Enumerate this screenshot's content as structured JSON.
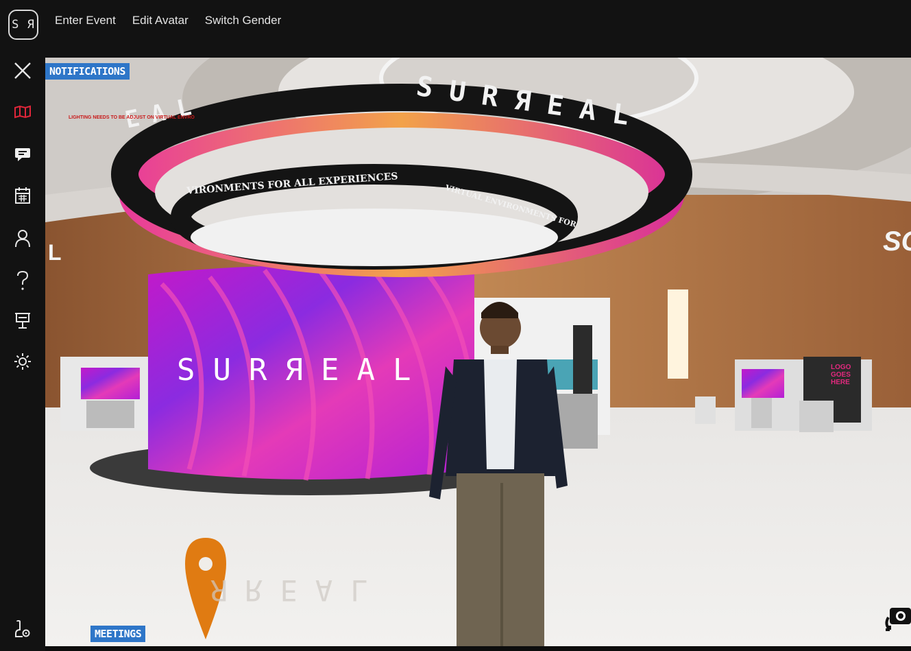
{
  "app": {
    "logo_text": "S Я"
  },
  "top_menu": {
    "items": [
      {
        "label": "Enter Event"
      },
      {
        "label": "Edit Avatar"
      },
      {
        "label": "Switch Gender"
      }
    ]
  },
  "sidebar": {
    "items": [
      {
        "icon": "close-icon"
      },
      {
        "icon": "map-icon",
        "color": "#e0263a"
      },
      {
        "icon": "chat-icon"
      },
      {
        "icon": "calendar-icon"
      },
      {
        "icon": "user-icon"
      },
      {
        "icon": "help-icon"
      },
      {
        "icon": "presentation-icon"
      },
      {
        "icon": "brightness-icon"
      },
      {
        "icon": "settings-user-icon"
      }
    ]
  },
  "scene": {
    "notifications_label": "NOTIFICATIONS",
    "ticker_text": "LIGHTING NEEDS TO BE ADJUST ON VIRTUAL ENVRO",
    "ring_brand": "SURЯEAL",
    "ring_brand_left": "EAL",
    "inner_ring_text": "VIRONMENTS FOR ALL EXPERIENCES",
    "inner_ring_text_2": "VIRTUAL ENVIRONMENTS FOR",
    "wall_brand": "SURЯEAL",
    "floor_reflection": "ЯREAL",
    "right_wall_text": "SC",
    "left_wall_text": "L",
    "booth_logo": "LOGO GOES HERE",
    "meetings_label": "MEETINGS",
    "accent_color": "#2e76c8",
    "pin_color": "#e07b12"
  }
}
